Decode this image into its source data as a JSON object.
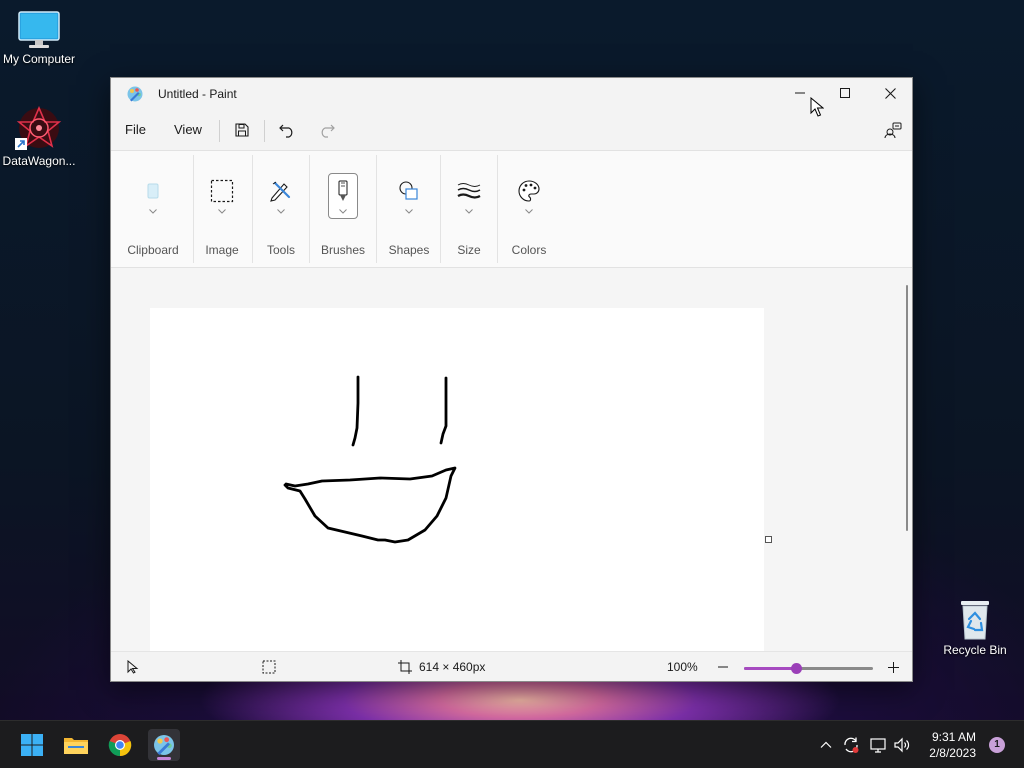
{
  "desktop": {
    "icons": [
      {
        "label": "My Computer"
      },
      {
        "label": "DataWagon..."
      },
      {
        "label": "Recycle Bin"
      }
    ]
  },
  "window": {
    "title": "Untitled - Paint",
    "menu": {
      "file": "File",
      "view": "View"
    },
    "ribbon": {
      "groups": [
        {
          "label": "Clipboard",
          "icon": "clipboard-icon"
        },
        {
          "label": "Image",
          "icon": "selection-icon"
        },
        {
          "label": "Tools",
          "icon": "pencil-icon"
        },
        {
          "label": "Brushes",
          "icon": "brush-icon"
        },
        {
          "label": "Shapes",
          "icon": "shapes-icon"
        },
        {
          "label": "Size",
          "icon": "stroke-size-icon"
        },
        {
          "label": "Colors",
          "icon": "palette-icon"
        }
      ]
    },
    "status": {
      "canvas_size": "614 × 460px",
      "zoom": "100%",
      "zoom_fraction": 0.4
    }
  },
  "taskbar": {
    "time": "9:31 AM",
    "date": "2/8/2023",
    "notification_count": "1"
  },
  "colors": {
    "accent": "#9b3fb8"
  }
}
